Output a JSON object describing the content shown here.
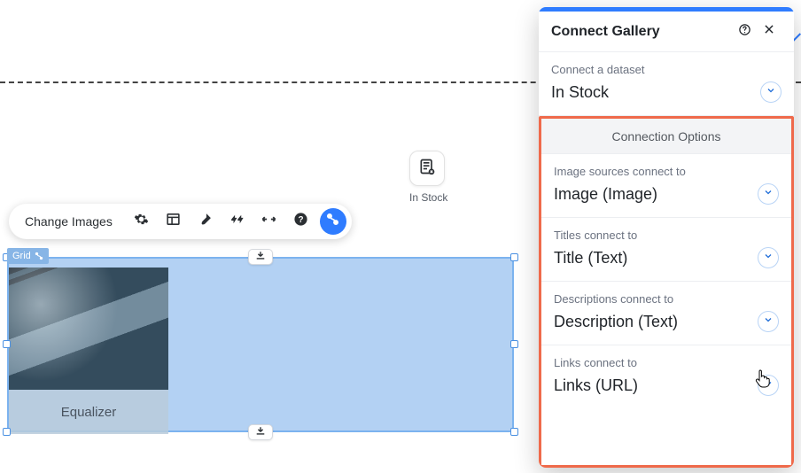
{
  "toolbar": {
    "change_images_label": "Change Images"
  },
  "dataset_chip": {
    "label": "In Stock"
  },
  "canvas": {
    "grid_tag": "Grid",
    "card_caption": "Equalizer"
  },
  "panel": {
    "title": "Connect Gallery",
    "connect_dataset": {
      "label": "Connect a dataset",
      "value": "In Stock"
    },
    "options_header": "Connection Options",
    "image_sources": {
      "label": "Image sources connect to",
      "value": "Image (Image)"
    },
    "titles": {
      "label": "Titles connect to",
      "value": "Title (Text)"
    },
    "descriptions": {
      "label": "Descriptions connect to",
      "value": "Description (Text)"
    },
    "links": {
      "label": "Links connect to",
      "value": "Links (URL)"
    }
  }
}
